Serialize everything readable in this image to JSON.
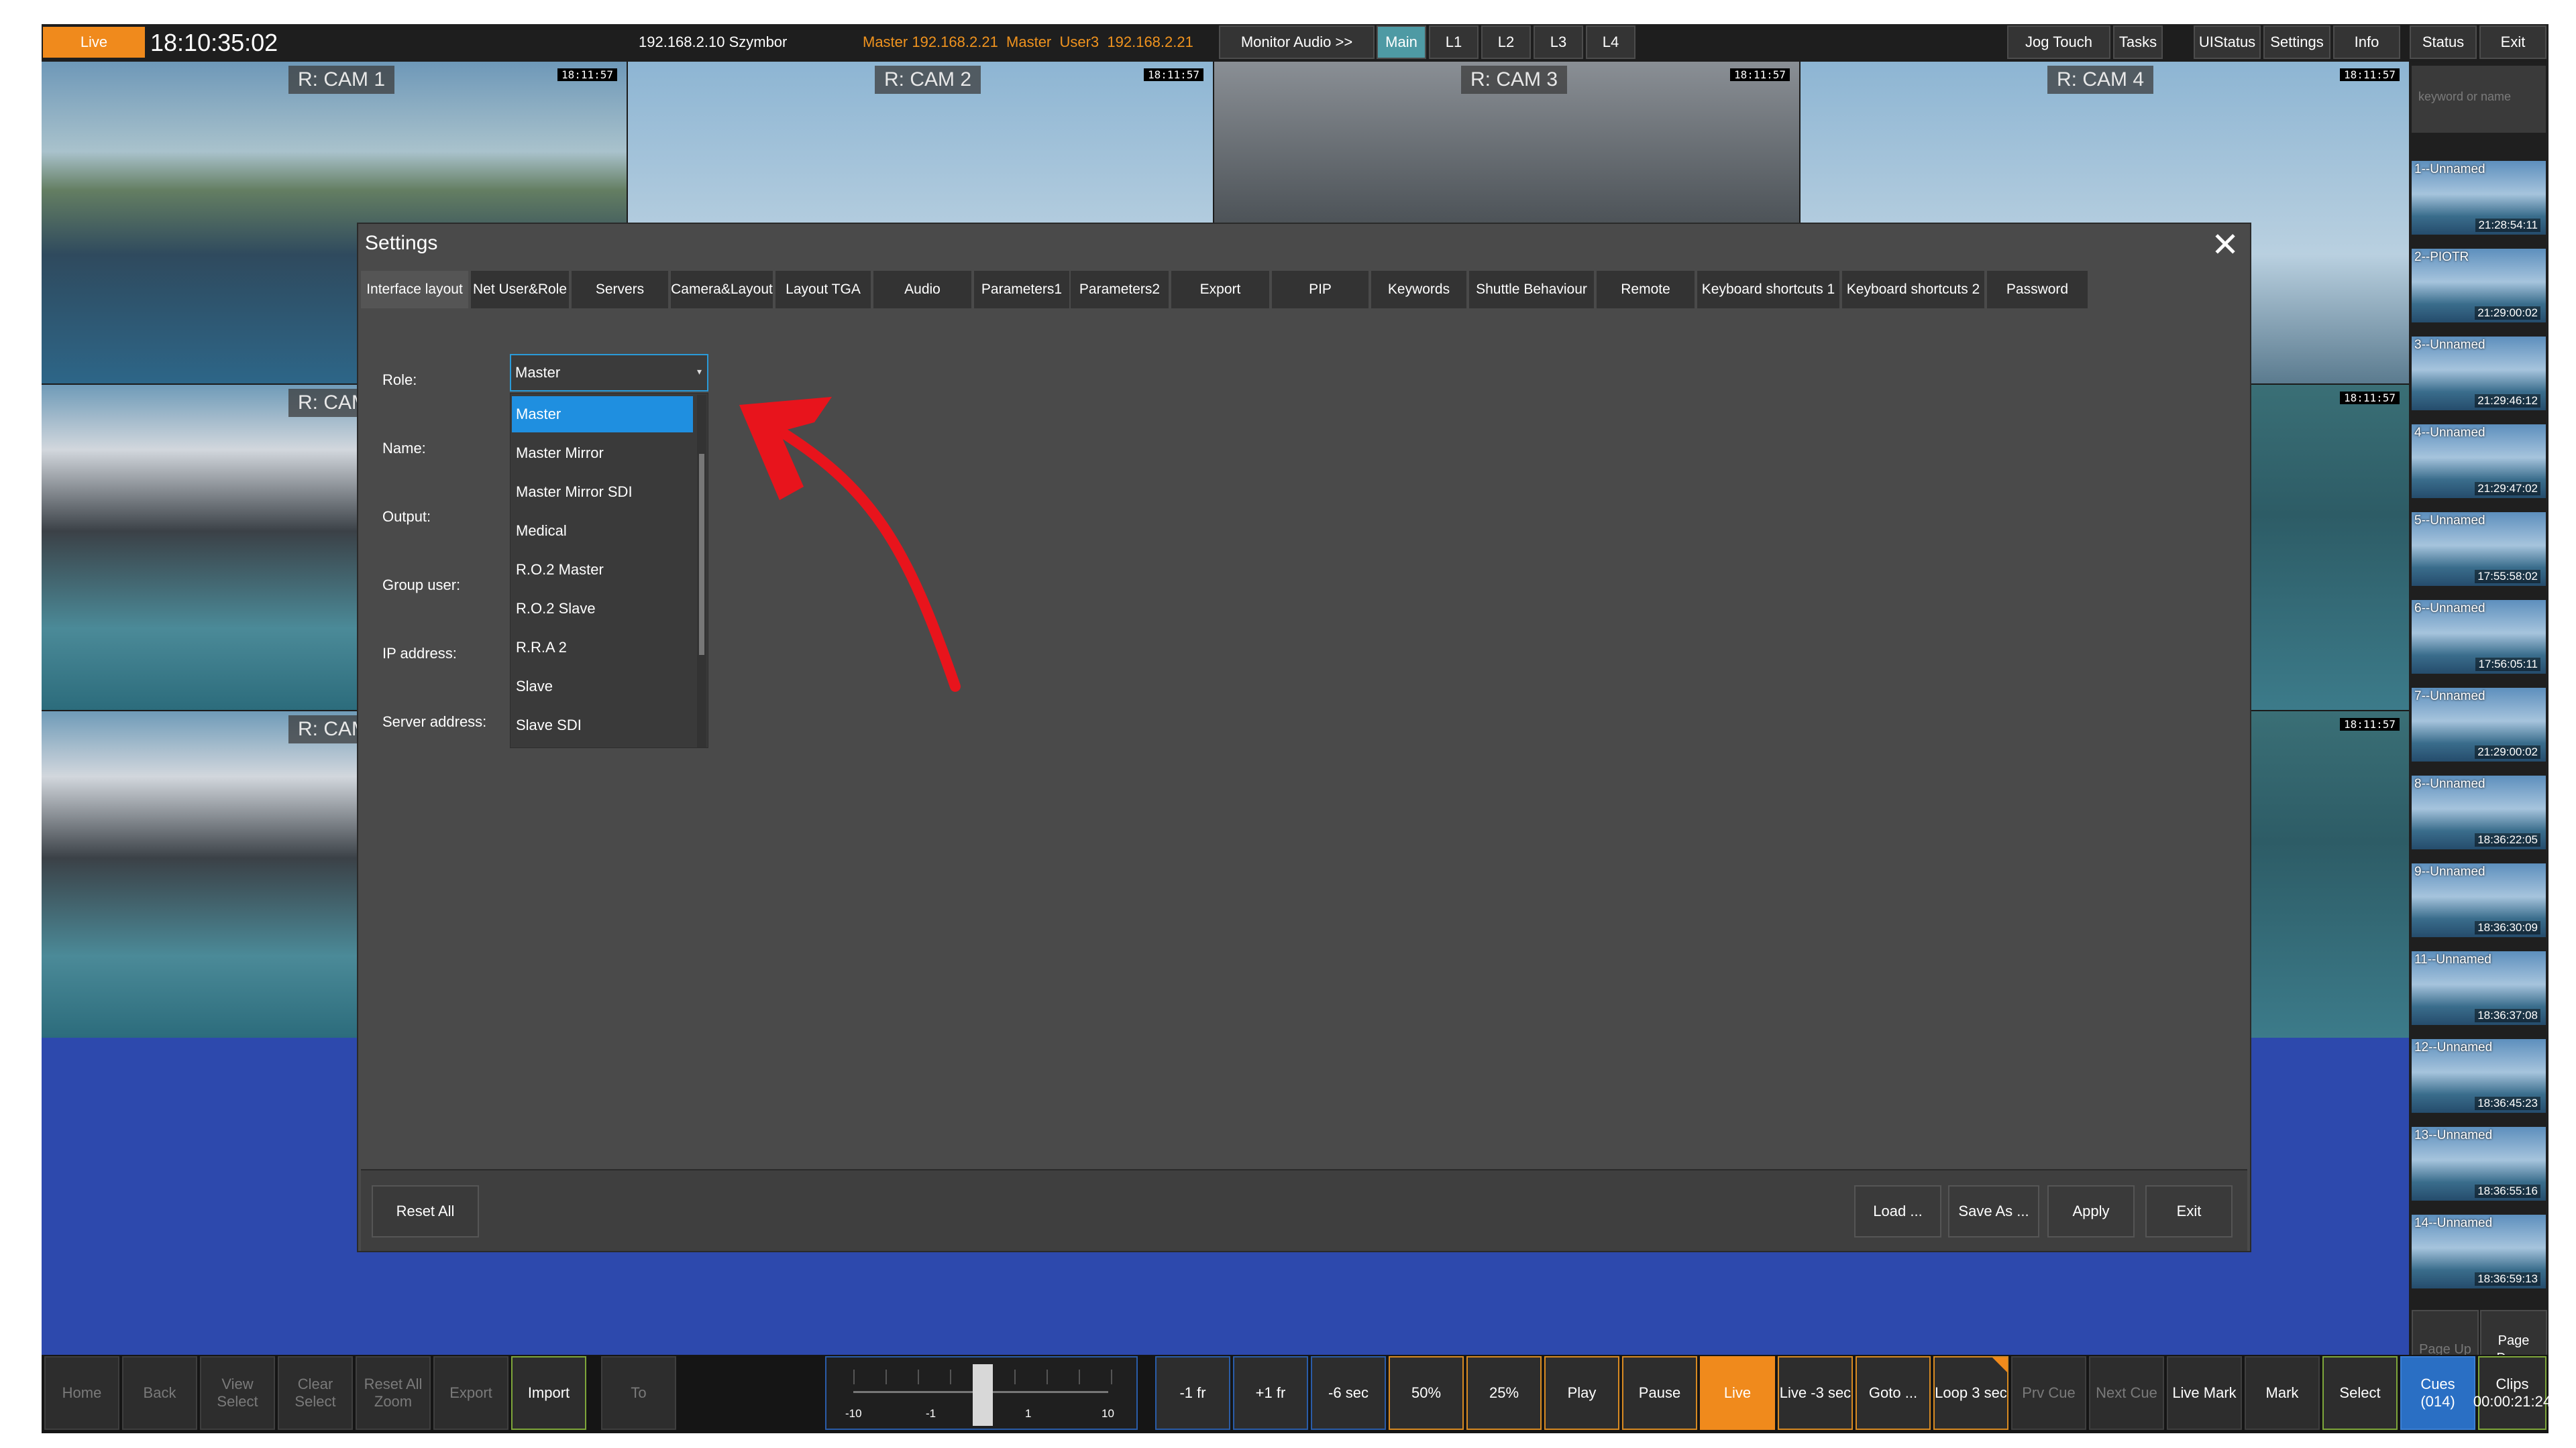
{
  "topbar": {
    "live": "Live",
    "clock": "18:10:35:02",
    "ip": "192.168.2.10 Szymbor",
    "master_info": "Master 192.168.2.21  Master  User3  192.168.2.21",
    "buttons": {
      "monitor_audio": "Monitor Audio >>",
      "main": "Main",
      "l1": "L1",
      "l2": "L2",
      "l3": "L3",
      "l4": "L4",
      "jog_touch": "Jog Touch",
      "tasks": "Tasks",
      "uistatus": "UIStatus",
      "settings": "Settings",
      "info": "Info",
      "status": "Status",
      "exit": "Exit"
    }
  },
  "cameras": {
    "cam1": "R: CAM 1",
    "cam2": "R: CAM 2",
    "cam3": "R: CAM 3",
    "cam4": "R: CAM 4",
    "cam5": "R: CAM",
    "cam6": "R: CAM",
    "timecode": "18:11:57"
  },
  "cliplist": {
    "search_placeholder": "keyword or name",
    "clips": [
      {
        "name": "1--Unnamed",
        "time": "21:28:54:11"
      },
      {
        "name": "2--PIOTR",
        "time": "21:29:00:02"
      },
      {
        "name": "3--Unnamed",
        "time": "21:29:46:12"
      },
      {
        "name": "4--Unnamed",
        "time": "21:29:47:02"
      },
      {
        "name": "5--Unnamed",
        "time": "17:55:58:02"
      },
      {
        "name": "6--Unnamed",
        "time": "17:56:05:11"
      },
      {
        "name": "7--Unnamed",
        "time": "21:29:00:02"
      },
      {
        "name": "8--Unnamed",
        "time": "18:36:22:05"
      },
      {
        "name": "9--Unnamed",
        "time": "18:36:30:09"
      },
      {
        "name": "11--Unnamed",
        "time": "18:36:37:08"
      },
      {
        "name": "12--Unnamed",
        "time": "18:36:45:23"
      },
      {
        "name": "13--Unnamed",
        "time": "18:36:55:16"
      },
      {
        "name": "14--Unnamed",
        "time": "18:36:59:13"
      }
    ],
    "page_up": "Page Up",
    "page_down": "Page Down"
  },
  "settings": {
    "title": "Settings",
    "tabs": [
      "Interface layout",
      "Net User&Role",
      "Servers",
      "Camera&Layout",
      "Layout TGA",
      "Audio",
      "Parameters1",
      "Parameters2",
      "Export",
      "PIP",
      "Keywords",
      "Shuttle Behaviour",
      "Remote",
      "Keyboard shortcuts 1",
      "Keyboard shortcuts 2",
      "Password"
    ],
    "labels": {
      "role": "Role:",
      "name": "Name:",
      "output": "Output:",
      "group_user": "Group user:",
      "ip_address": "IP address:",
      "server_address": "Server address:"
    },
    "role_value": "Master",
    "role_options": [
      "Master",
      "Master Mirror",
      "Master Mirror SDI",
      "Medical",
      "R.O.2 Master",
      "R.O.2 Slave",
      "R.R.A 2",
      "Slave",
      "Slave SDI"
    ],
    "footer": {
      "reset_all": "Reset All",
      "load": "Load ...",
      "save_as": "Save As ...",
      "apply": "Apply",
      "exit": "Exit"
    }
  },
  "bottombar": {
    "home": "Home",
    "back": "Back",
    "view_select": "View Select",
    "clear_select": "Clear Select",
    "reset_all_zoom": "Reset All Zoom",
    "export": "Export",
    "import": "Import",
    "to": "To",
    "shuttle_labels": [
      "-10",
      "-1",
      "1",
      "10"
    ],
    "minus1fr": "-1 fr",
    "plus1fr": "+1 fr",
    "minus6sec": "-6 sec",
    "p50": "50%",
    "p25": "25%",
    "play": "Play",
    "pause": "Pause",
    "live": "Live",
    "live3sec": "Live -3 sec",
    "goto": "Goto ...",
    "loop": "Loop 3 sec",
    "prv_cue": "Prv Cue",
    "next_cue": "Next Cue",
    "live_mark": "Live Mark",
    "mark": "Mark",
    "select": "Select",
    "cues": "Cues (014)",
    "clips": "Clips 00:00:21:24"
  },
  "colors": {
    "accent_orange": "#f08a1c",
    "selected_blue": "#1f8fe0",
    "annotation_red": "#e8141c",
    "background_blue": "#2d49ad"
  }
}
